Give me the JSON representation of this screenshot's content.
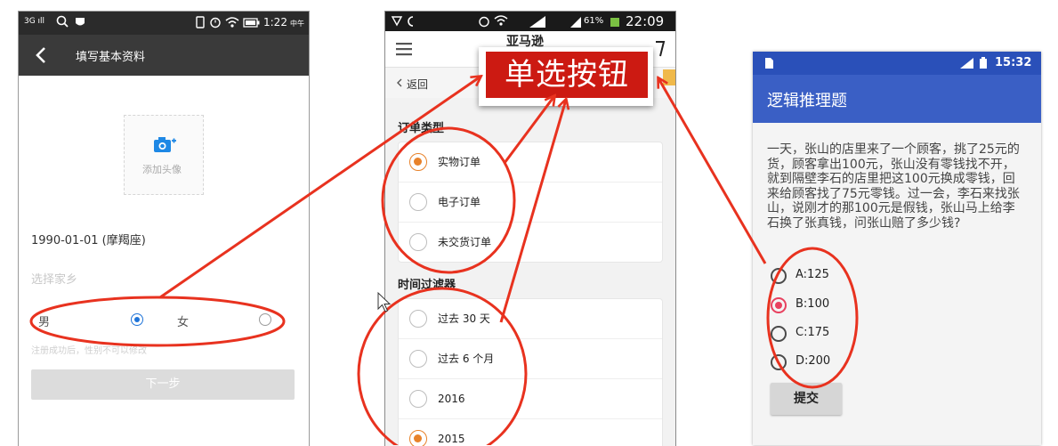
{
  "phone1": {
    "status_bar": {
      "network": "3G ıll",
      "time": "1:22",
      "time_suffix": "中午"
    },
    "title": "填写基本资料",
    "avatar_label": "添加头像",
    "birthday": "1990-01-01 (摩羯座)",
    "hometown_placeholder": "选择家乡",
    "gender_options": [
      {
        "label": "男",
        "selected": true
      },
      {
        "label": "女",
        "selected": false
      }
    ],
    "hint": "注册成功后，性别不可以修改",
    "next_button": "下一步"
  },
  "phone2": {
    "status_bar": {
      "battery": "61%",
      "time": "22:09"
    },
    "logo": "亚马逊",
    "back_label": "返回",
    "sections": [
      {
        "title": "订单类型",
        "options": [
          {
            "label": "实物订单",
            "selected": true
          },
          {
            "label": "电子订单",
            "selected": false
          },
          {
            "label": "未交货订单",
            "selected": false
          }
        ]
      },
      {
        "title": "时间过滤器",
        "options": [
          {
            "label": "过去 30 天",
            "selected": false
          },
          {
            "label": "过去 6 个月",
            "selected": false
          },
          {
            "label": "2016",
            "selected": false
          },
          {
            "label": "2015",
            "selected": true
          }
        ]
      }
    ]
  },
  "phone3": {
    "status_bar": {
      "time": "15:32"
    },
    "title": "逻辑推理题",
    "question": "一天，张山的店里来了一个顾客，挑了25元的货，顾客拿出100元，张山没有零钱找不开，就到隔壁李石的店里把这100元换成零钱，回来给顾客找了75元零钱。过一会，李石来找张山，说刚才的那100元是假钱，张山马上给李石换了张真钱，问张山赔了多少钱?",
    "options": [
      {
        "label": "A:125",
        "selected": false
      },
      {
        "label": "B:100",
        "selected": true
      },
      {
        "label": "C:175",
        "selected": false
      },
      {
        "label": "D:200",
        "selected": false
      }
    ],
    "submit_label": "提交"
  },
  "callout": {
    "label": "单选按钮"
  },
  "colors": {
    "annotation_red": "#e8321f",
    "callout_red": "#cc1a12",
    "amazon_orange": "#e8822a",
    "android_blue": "#3a5fc5",
    "radio_pink": "#e8415f",
    "radio_blue": "#1e73d8"
  },
  "icons": [
    "back-arrow-icon",
    "search-icon",
    "camera-icon",
    "menu-icon",
    "cart-icon",
    "chevron-left-icon",
    "mouse-cursor-icon",
    "battery-icon",
    "wifi-icon",
    "alarm-icon"
  ]
}
